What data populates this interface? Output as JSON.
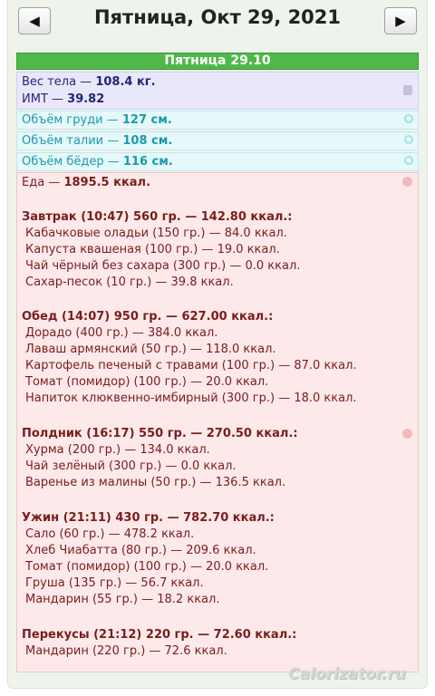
{
  "header": {
    "prev_label": "◀",
    "next_label": "▶",
    "date_title": "Пятница, Окт 29, 2021"
  },
  "day_bar": "Пятница 29.10",
  "body": {
    "weight_label": "Вес тела — ",
    "weight_value": "108.4 кг.",
    "bmi_label": "ИМТ — ",
    "bmi_value": "39.82"
  },
  "measurements": [
    {
      "label": "Объём груди — ",
      "value": "127 см."
    },
    {
      "label": "Объём талии — ",
      "value": "108 см."
    },
    {
      "label": "Объём бёдер — ",
      "value": "116 см."
    }
  ],
  "food": {
    "total_label": "Еда — ",
    "total_value": "1895.5 ккал.",
    "meals": [
      {
        "title": "Завтрак (10:47) 560 гр. — 142.80 ккал.:",
        "items": [
          "Кабачковые оладьи (150 гр.) — 84.0 ккал.",
          "Капуста квашеная (100 гр.) — 19.0 ккал.",
          "Чай чёрный без сахара (300 гр.) — 0.0 ккал.",
          "Сахар-песок (10 гр.) — 39.8 ккал."
        ]
      },
      {
        "title": "Обед (14:07) 950 гр. — 627.00 ккал.:",
        "items": [
          "Дорадо (400 гр.) — 384.0 ккал.",
          "Лаваш армянский (50 гр.) — 118.0 ккал.",
          "Картофель печеный с травами (100 гр.) — 87.0 ккал.",
          "Томат (помидор) (100 гр.) — 20.0 ккал.",
          "Напиток клюквенно-имбирный (300 гр.) — 18.0 ккал."
        ]
      },
      {
        "title": "Полдник (16:17) 550 гр. — 270.50 ккал.:",
        "items": [
          "Хурма (200 гр.) — 134.0 ккал.",
          "Чай зелёный (300 гр.) — 0.0 ккал.",
          "Варенье из малины (50 гр.) — 136.5 ккал."
        ]
      },
      {
        "title": "Ужин (21:11) 430 гр. — 782.70 ккал.:",
        "items": [
          "Сало (60 гр.) — 478.2 ккал.",
          "Хлеб Чиабатта (80 гр.) — 209.6 ккал.",
          "Томат (помидор) (100 гр.) — 20.0 ккал.",
          "Груша (135 гр.) — 56.7 ккал.",
          "Мандарин (55 гр.) — 18.2 ккал."
        ]
      },
      {
        "title": "Перекусы (21:12) 220 гр. — 72.60 ккал.:",
        "items": [
          "Мандарин (220 гр.) — 72.6 ккал."
        ]
      }
    ]
  },
  "watermark": "Calorizator.ru",
  "colors": {
    "day_bar": "#4fb84a",
    "weight_bg": "#e9e8fa",
    "measure_bg": "#e5f8fa",
    "food_bg": "#fde9e9",
    "food_text": "#7a1c1c"
  },
  "icons": {
    "prev": "triangle-left",
    "next": "triangle-right",
    "weight": "scale-icon",
    "measure": "tape-icon",
    "food": "apple-icon"
  }
}
